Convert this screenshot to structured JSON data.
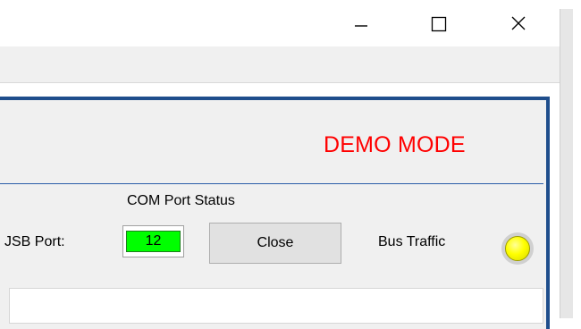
{
  "window": {
    "minimize_icon": "minimize-icon",
    "maximize_icon": "maximize-icon",
    "close_icon": "close-icon"
  },
  "banner": {
    "mode_text": "DEMO MODE",
    "mode_color": "#ff0000"
  },
  "com": {
    "status_label": "COM Port Status",
    "usb_label": "JSB Port:",
    "port_number": "12",
    "port_indicator_color": "#00ff00",
    "close_label": "Close"
  },
  "bus": {
    "label": "Bus Traffic",
    "led_color": "#ffff00"
  },
  "colors": {
    "panel_border": "#1f4e8c"
  }
}
